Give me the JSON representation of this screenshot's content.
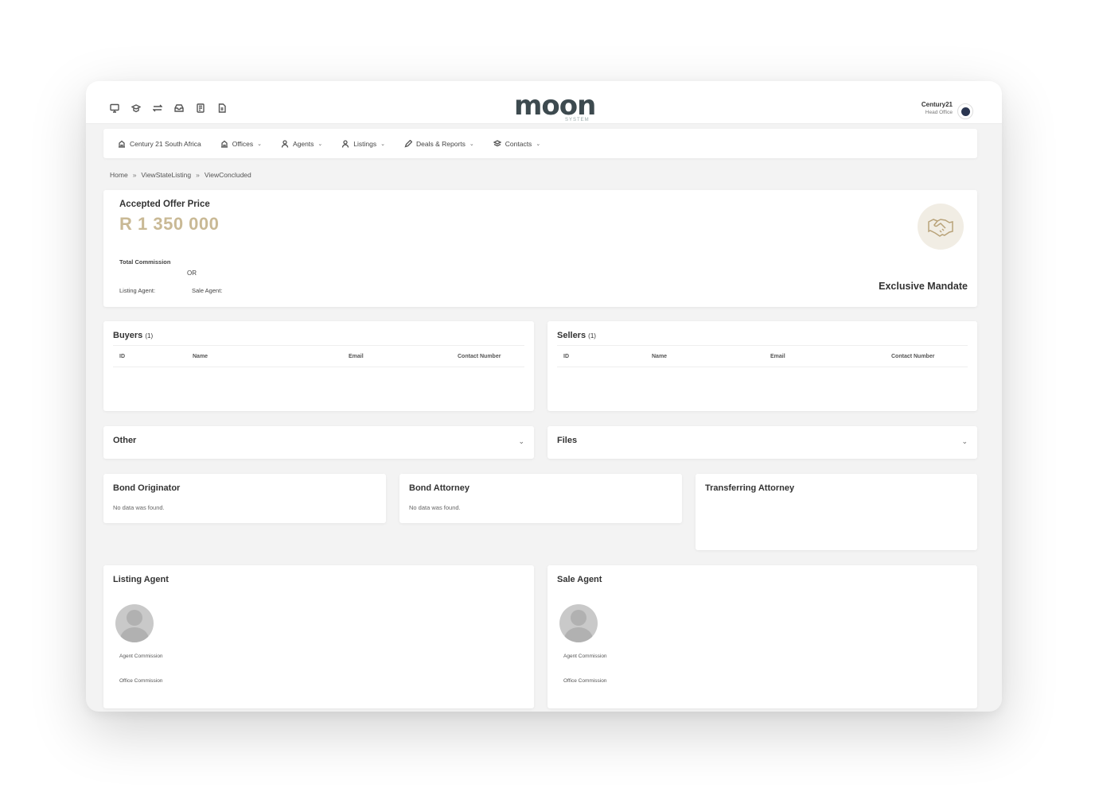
{
  "header": {
    "icons": [
      "monitor-icon",
      "graduation-cap-icon",
      "transfer-arrows-icon",
      "inbox-icon",
      "book-icon",
      "document-icon"
    ],
    "logo_text": "moon",
    "logo_sub": "SYSTEM",
    "org_name": "Century21",
    "org_sub": "Head Office"
  },
  "nav": {
    "items": [
      {
        "label": "Century 21 South Africa",
        "icon": "building-icon",
        "dropdown": false
      },
      {
        "label": "Offices",
        "icon": "building-icon",
        "dropdown": true
      },
      {
        "label": "Agents",
        "icon": "user-icon",
        "dropdown": true
      },
      {
        "label": "Listings",
        "icon": "user-icon",
        "dropdown": true
      },
      {
        "label": "Deals & Reports",
        "icon": "pencil-icon",
        "dropdown": true
      },
      {
        "label": "Contacts",
        "icon": "layers-icon",
        "dropdown": true
      }
    ]
  },
  "breadcrumb": {
    "items": [
      "Home",
      "ViewStateListing",
      "ViewConcluded"
    ],
    "separator": "»"
  },
  "offer": {
    "title": "Accepted Offer Price",
    "price": "R 1 350 000",
    "total_commission_label": "Total Commission",
    "or_label": "OR",
    "listing_agent_label": "Listing Agent:",
    "sale_agent_label": "Sale Agent:",
    "mandate": "Exclusive Mandate"
  },
  "buyers": {
    "title": "Buyers",
    "count": "(1)",
    "columns": [
      "ID",
      "Name",
      "Email",
      "Contact Number"
    ]
  },
  "sellers": {
    "title": "Sellers",
    "count": "(1)",
    "columns": [
      "ID",
      "Name",
      "Email",
      "Contact Number"
    ]
  },
  "other": {
    "title": "Other",
    "caret": "⌄"
  },
  "files": {
    "title": "Files",
    "caret": "⌄"
  },
  "bond_originator": {
    "title": "Bond Originator",
    "empty": "No data was found."
  },
  "bond_attorney": {
    "title": "Bond Attorney",
    "empty": "No data was found."
  },
  "transferring_attorney": {
    "title": "Transferring Attorney"
  },
  "listing_agent": {
    "title": "Listing Agent",
    "agent_commission": "Agent Commission",
    "office_commission": "Office Commission"
  },
  "sale_agent": {
    "title": "Sale Agent",
    "agent_commission": "Agent Commission",
    "office_commission": "Office Commission"
  },
  "colors": {
    "accent_gold": "#c9b995",
    "logo": "#3d4a4f",
    "background": "#f3f3f3"
  }
}
